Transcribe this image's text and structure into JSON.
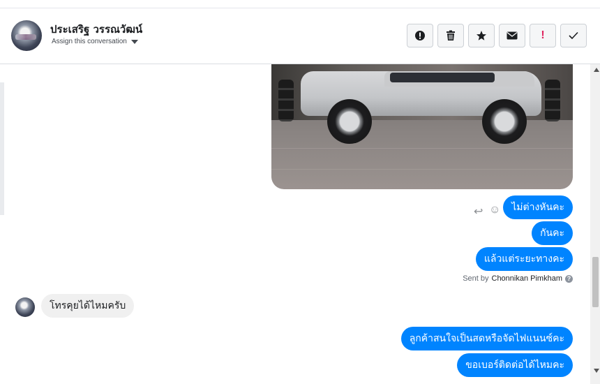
{
  "header": {
    "contact_name": "ประเสริฐ วรรณวัฒน์",
    "assign_label": "Assign this conversation"
  },
  "toolbar": {
    "buttons": [
      {
        "icon": "alert-circle-icon",
        "glyph": "!"
      },
      {
        "icon": "trash-icon",
        "glyph": "🗑"
      },
      {
        "icon": "star-icon",
        "glyph": "★"
      },
      {
        "icon": "envelope-icon",
        "glyph": "✉"
      },
      {
        "icon": "exclamation-icon",
        "glyph": "!"
      },
      {
        "icon": "checkmark-icon",
        "glyph": "✓"
      }
    ]
  },
  "messages": {
    "out_1": "ไม่ต่างหันคะ",
    "out_2": "กันคะ",
    "out_3": "แล้วแต่ระยะทางคะ",
    "sent_by_prefix": "Sent by",
    "sent_by_name": "Chonnikan Pimkham",
    "in_1": "โทรคุยได้ไหมครับ",
    "out_4": "ลูกค้าสนใจเป็นสดหรือจัดไฟแนนซ์คะ",
    "out_5": "ขอเบอร์ติดต่อได้ไหมคะ"
  },
  "colors": {
    "outgoing_bubble": "#0084ff",
    "incoming_bubble": "#f0f0f0",
    "danger": "#e0245e"
  }
}
